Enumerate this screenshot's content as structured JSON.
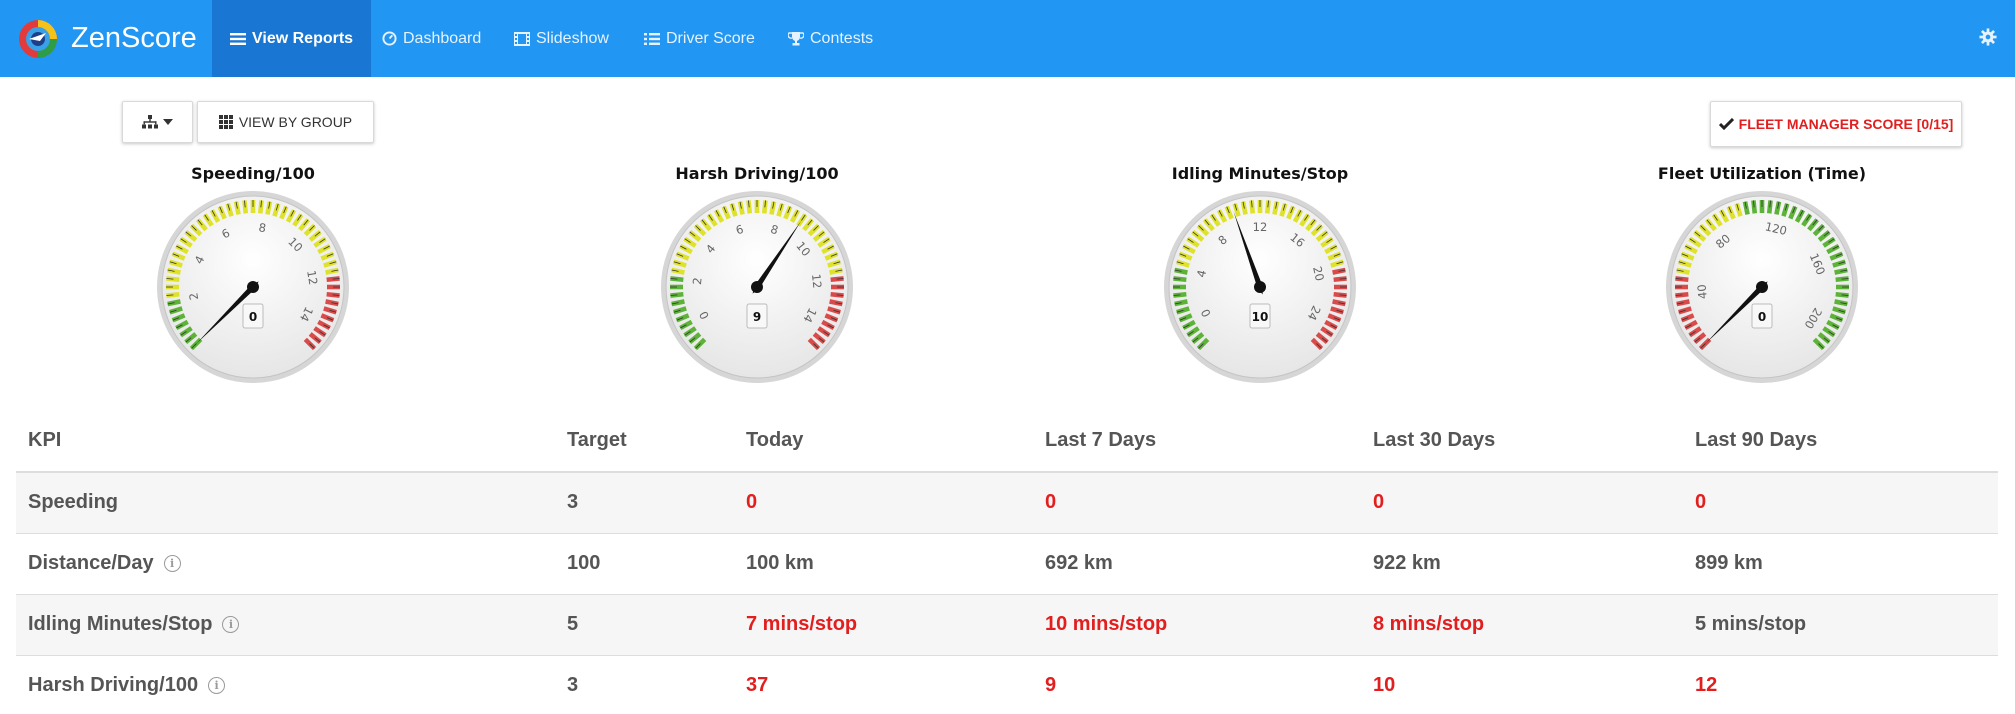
{
  "app": {
    "name": "ZenScore",
    "nav": [
      {
        "label": "View Reports",
        "icon": "list-icon",
        "active": true
      },
      {
        "label": "Dashboard",
        "icon": "dashboard-icon",
        "active": false
      },
      {
        "label": "Slideshow",
        "icon": "film-icon",
        "active": false
      },
      {
        "label": "Driver Score",
        "icon": "list-icon",
        "active": false
      },
      {
        "label": "Contests",
        "icon": "trophy-icon",
        "active": false
      }
    ],
    "settings_icon": "gear-icon"
  },
  "toolbar": {
    "group_tree_icon": "sitemap-icon",
    "view_by_group_label": "VIEW BY GROUP",
    "fleet_manager_label": "FLEET MANAGER SCORE [0/15]"
  },
  "gauges": [
    {
      "title": "Speeding/100",
      "value": "0",
      "min": 0,
      "max": 15,
      "ticks": [
        "2",
        "4",
        "6",
        "8",
        "10",
        "12",
        "14"
      ],
      "needle": 0,
      "bands": {
        "green": [
          0,
          2
        ],
        "yellow": [
          2,
          11
        ],
        "red": [
          12,
          15
        ]
      }
    },
    {
      "title": "Harsh Driving/100",
      "value": "9",
      "min": -1,
      "max": 15,
      "ticks": [
        "0",
        "2",
        "4",
        "6",
        "8",
        "10",
        "12",
        "14"
      ],
      "needle": 9,
      "bands": {
        "green": [
          -1,
          2
        ],
        "yellow": [
          2,
          11
        ],
        "red": [
          12,
          15
        ]
      }
    },
    {
      "title": "Idling Minutes/Stop",
      "value": "10",
      "min": -2,
      "max": 26,
      "ticks": [
        "0",
        "4",
        "8",
        "12",
        "16",
        "20",
        "24"
      ],
      "needle": 10,
      "bands": {
        "green": [
          -2,
          4
        ],
        "yellow": [
          4,
          19
        ],
        "red": [
          20,
          26
        ]
      }
    },
    {
      "title": "Fleet Utilization (Time)",
      "value": "0",
      "min": 10,
      "max": 210,
      "ticks": [
        "40",
        "80",
        "120",
        "160",
        "200"
      ],
      "needle": 0,
      "bands": {
        "red": [
          10,
          50
        ],
        "yellow": [
          50,
          100
        ],
        "green": [
          100,
          210
        ]
      }
    }
  ],
  "table": {
    "headers": [
      "KPI",
      "Target",
      "Today",
      "Last 7 Days",
      "Last 30 Days",
      "Last 90 Days"
    ],
    "rows": [
      {
        "kpi": "Speeding",
        "info": false,
        "target": "3",
        "today": "0",
        "d7": "0",
        "d30": "0",
        "d90": "0",
        "red": [
          true,
          true,
          true,
          true
        ]
      },
      {
        "kpi": "Distance/Day",
        "info": true,
        "target": "100",
        "today": "100 km",
        "d7": "692 km",
        "d30": "922 km",
        "d90": "899 km",
        "red": [
          false,
          false,
          false,
          false
        ]
      },
      {
        "kpi": "Idling Minutes/Stop",
        "info": true,
        "target": "5",
        "today": "7 mins/stop",
        "d7": "10 mins/stop",
        "d30": "8 mins/stop",
        "d90": "5 mins/stop",
        "red": [
          true,
          true,
          true,
          false
        ]
      },
      {
        "kpi": "Harsh Driving/100",
        "info": true,
        "target": "3",
        "today": "37",
        "d7": "9",
        "d30": "10",
        "d90": "12",
        "red": [
          true,
          true,
          true,
          true
        ]
      }
    ]
  },
  "colors": {
    "nav": "#2196f3",
    "nav_active": "#1976d2",
    "alert_red": "#e21e1e",
    "gauge_green": "#5cb338",
    "gauge_yellow": "#dfe22a",
    "gauge_red": "#d94b4b"
  }
}
